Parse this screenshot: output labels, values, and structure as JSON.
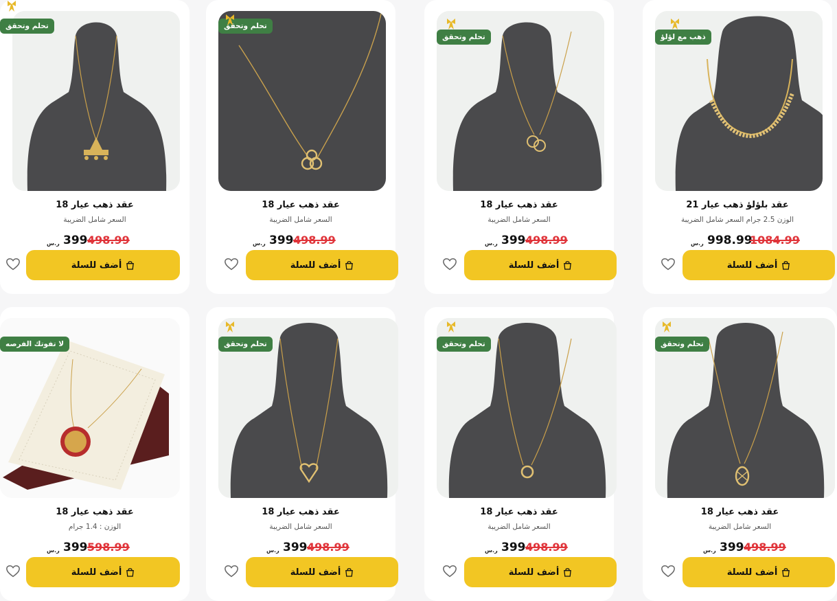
{
  "currency": "ر.س",
  "cart_label": "أضف للسلة",
  "products": [
    {
      "title": "عقد ذهب عيار 18",
      "subtitle": "السعر شامل الضريبة",
      "price": "399",
      "old_price": "498.99",
      "badge": "تحلم وتحقق",
      "image": "bust-light-pendant-letter"
    },
    {
      "title": "عقد ذهب عيار 18",
      "subtitle": "السعر شامل الضريبة",
      "price": "399",
      "old_price": "498.99",
      "badge": "تحلم وتحقق",
      "image": "dark-board-heart-clover"
    },
    {
      "title": "عقد ذهب عيار 18",
      "subtitle": "السعر شامل الضريبة",
      "price": "399",
      "old_price": "498.99",
      "badge": "تحلم وتحقق",
      "image": "bust-double-ring"
    },
    {
      "title": "عقد بلؤلؤ ذهب عيار 21",
      "subtitle": "الوزن 2.5 جرام السعر شامل الضريبة",
      "price": "998.99",
      "old_price": "1084.99",
      "badge": "ذهب مع لؤلؤ",
      "image": "bust-pearl-rope"
    },
    {
      "title": "عقد ذهب عيار 18",
      "subtitle": "الوزن : 1.4 جرام",
      "price": "399",
      "old_price": "598.99",
      "badge": "لا تفوتك الفرصه",
      "image": "box-red-coin"
    },
    {
      "title": "عقد ذهب عيار 18",
      "subtitle": "السعر شامل الضريبة",
      "price": "399",
      "old_price": "498.99",
      "badge": "تحلم وتحقق",
      "image": "bust-heart-link"
    },
    {
      "title": "عقد ذهب عيار 18",
      "subtitle": "السعر شامل الضريبة",
      "price": "399",
      "old_price": "498.99",
      "badge": "تحلم وتحقق",
      "image": "bust-circle-pendant"
    },
    {
      "title": "عقد ذهب عيار 18",
      "subtitle": "السعر شامل الضريبة",
      "price": "399",
      "old_price": "498.99",
      "badge": "تحلم وتحقق",
      "image": "bust-oval-pendant"
    }
  ],
  "colors": {
    "cart_button": "#f2c623",
    "badge": "#3f7f44",
    "old_price": "#e0343a",
    "bust": "#4a4a4c"
  }
}
